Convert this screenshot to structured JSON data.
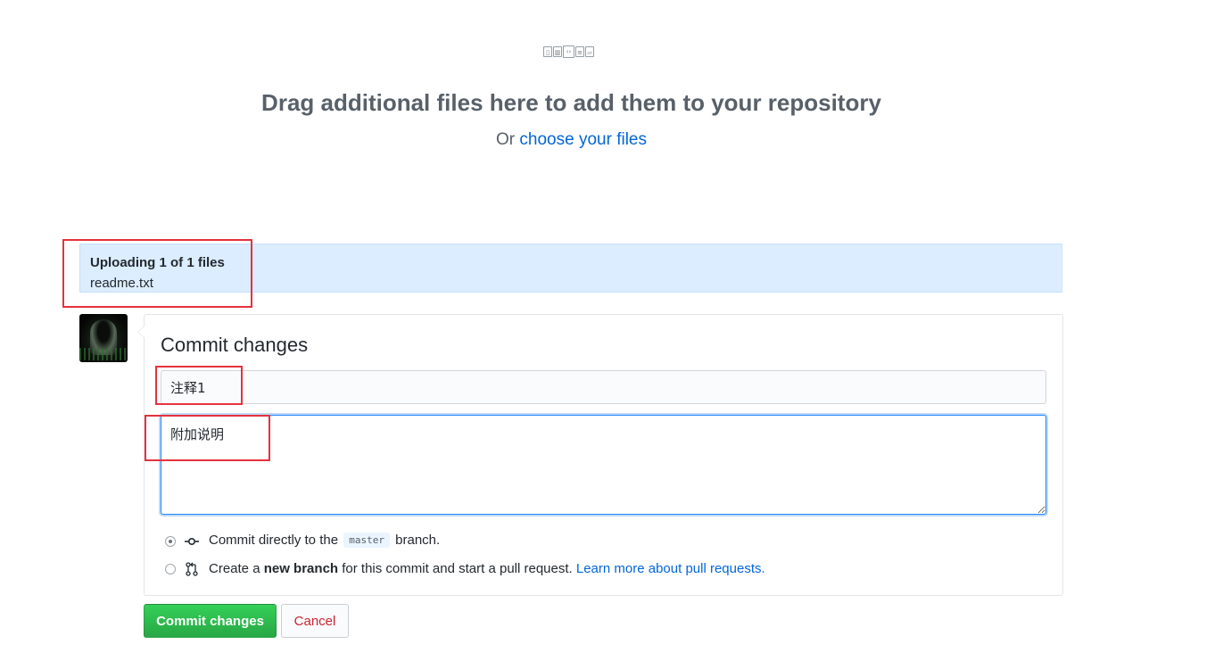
{
  "dropzone": {
    "file_icon_names": [
      "file-icon",
      "file-media-icon",
      "file-code-icon",
      "file-text-icon",
      "file-pdf-icon"
    ],
    "title": "Drag additional files here to add them to your repository",
    "prefix": "Or",
    "link": "choose your files"
  },
  "upload": {
    "status": "Uploading 1 of 1 files",
    "file": "readme.txt"
  },
  "commit": {
    "heading": "Commit changes",
    "summary_value": "注释1",
    "description_value": "附加说明",
    "option_direct": {
      "prefix": "Commit directly to the",
      "branch": "master",
      "suffix": "branch.",
      "selected": true
    },
    "option_new": {
      "prefix": "Create a",
      "bold": "new branch",
      "suffix": "for this commit and start a pull request.",
      "link": "Learn more about pull requests.",
      "selected": false
    },
    "submit_label": "Commit changes",
    "cancel_label": "Cancel"
  },
  "colors": {
    "link": "#0366d6",
    "upload_bg": "#dbedff",
    "commit_button": "#28a745",
    "cancel_text": "#cb2431",
    "highlight_box": "#e5323e"
  }
}
